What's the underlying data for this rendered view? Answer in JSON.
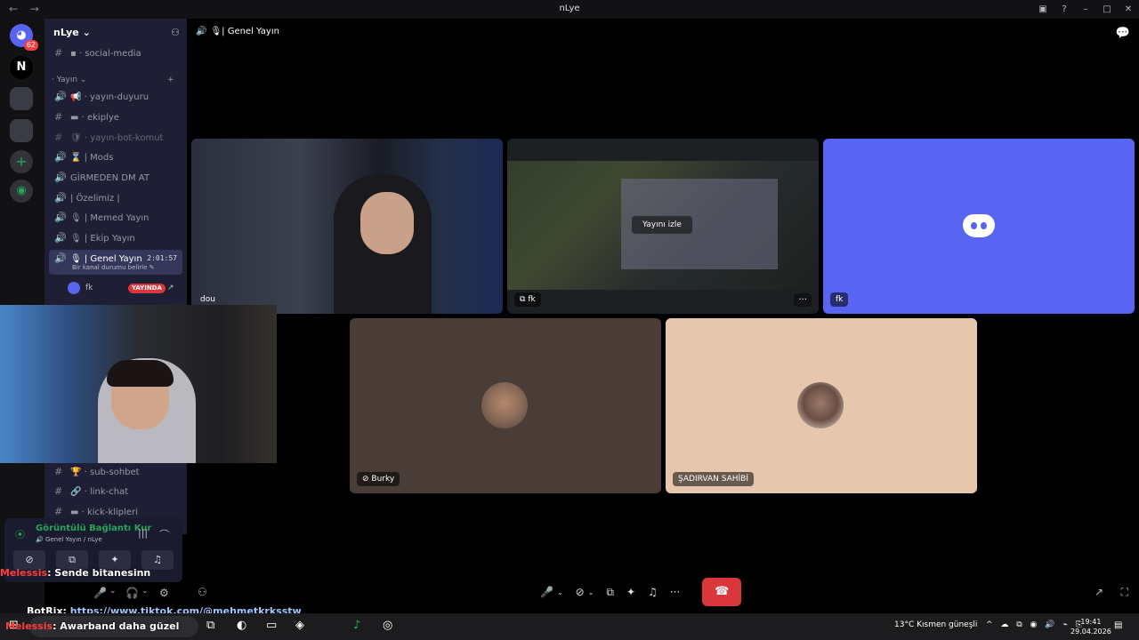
{
  "window": {
    "title": "nLye",
    "back_icon": "←",
    "forward_icon": "→",
    "inbox_icon": "▣",
    "help_icon": "?",
    "minimize_icon": "–",
    "maximize_icon": "□",
    "close_icon": "✕"
  },
  "guilds": {
    "dm_badge": "62",
    "server_initial": "N",
    "add_icon": "+",
    "discover_icon": "◉"
  },
  "server": {
    "name": "nLye",
    "caret": "⌄",
    "invite_icon": "⚇",
    "channels": [
      {
        "name": "▪ · social-media",
        "icon": "#"
      },
      {
        "name": "📢 · yayın-duyuru",
        "icon": "🔊"
      },
      {
        "name": "▬ · ekiplye",
        "icon": "#"
      },
      {
        "name": "🛡 · yayın-bot-komut",
        "icon": "#"
      },
      {
        "name": "⌛ | Mods",
        "icon": "🔊"
      },
      {
        "name": "GİRMEDEN DM AT",
        "icon": "🔊"
      },
      {
        "name": "| Özelimiz |",
        "icon": "🔊"
      },
      {
        "name": "🎙 | Memed Yayın",
        "icon": "🔊"
      },
      {
        "name": "🎙 | Ekip Yayın",
        "icon": "🔊"
      }
    ],
    "category_yayin": "· Yayın ⌄",
    "category_plus": "+",
    "active_channel": {
      "name": "🎙 | Genel Yayın",
      "icon": "🔊",
      "timer": "2:01:57",
      "status": "Bir kanal durumu belirle ✎"
    },
    "members": [
      {
        "name": "fk",
        "live": "YAYINDA",
        "live_icon": "↗"
      }
    ],
    "lower_channels": [
      {
        "name": "🏆 · sub-sohbet",
        "icon": "#"
      },
      {
        "name": "🔗 · link-chat",
        "icon": "#"
      },
      {
        "name": "▬ · kick-klipleri",
        "icon": "#"
      }
    ]
  },
  "voice_panel": {
    "status": "Görüntülü Bağlantı Kur",
    "location": "🔊 Genel Yayın / nLye",
    "signal_icon": "⦿",
    "wave_icon": "|||",
    "disconnect_icon": "⌒",
    "camera_btn": "⊘",
    "screen_btn": "⧉",
    "activity_btn": "✦",
    "soundboard_btn": "♫"
  },
  "user_bar": {
    "mic_icon": "🎤",
    "caret": "⌄",
    "headset_icon": "🎧",
    "settings_icon": "⚙"
  },
  "main": {
    "channel_title": "🎙| Genel Yayın",
    "header_icon": "🔊",
    "chat_icon": "💬",
    "tiles": {
      "dou": "dou",
      "screen": "fk",
      "screen_prefix": "⧉",
      "watch": "Yayını izle",
      "more": "···",
      "fk": "fk",
      "burky": "Burky",
      "burky_icon": "⊘",
      "sadir": "ŞADIRVAN SAHİBİ"
    },
    "controls": {
      "mic": "🎤",
      "mic_caret": "⌄",
      "camera": "⊘",
      "camera_caret": "⌄",
      "screen": "⧉",
      "activity": "✦",
      "soundboard": "♫",
      "more": "···",
      "leave": "☎"
    },
    "invite_icon": "⚇",
    "popout_icon": "↗",
    "fullscreen_icon": "⛶"
  },
  "chat_overlay": [
    {
      "user": "Melessis",
      "message": ": Sende bitanesinn"
    },
    {
      "user": "BotRix",
      "message": ": ",
      "link": "https://www.tiktok.com/@mehmetkrksstw"
    },
    {
      "user": "Melessis",
      "message": ": Awarband daha güzel"
    }
  ],
  "taskbar": {
    "start": "⊞",
    "taskview": "⧉",
    "apps": [
      "◐",
      "▭",
      "◈",
      "♪",
      "◎"
    ],
    "weather": "13°C  Kısmen güneşli",
    "tray": "^ ☁ ⧉ ◉ 🔊 ⌁ ⎘",
    "time": "19:41",
    "date": "29.04.2026",
    "notif": "▤"
  },
  "colors": {
    "accent": "#5865f2",
    "danger": "#da373c",
    "online": "#23a559",
    "sidebar": "#1e1f35"
  }
}
